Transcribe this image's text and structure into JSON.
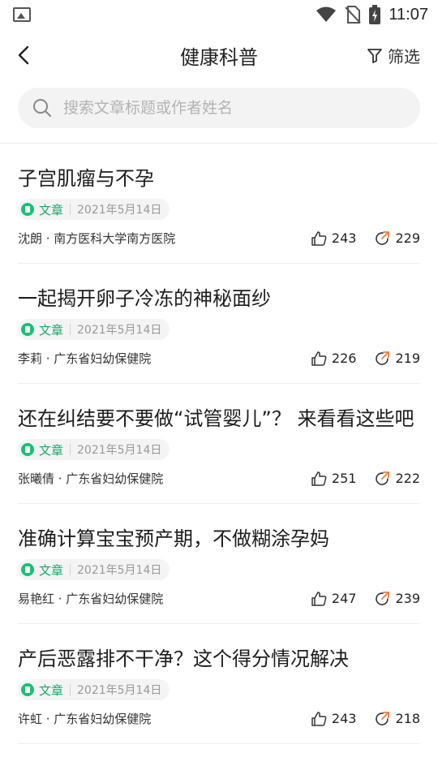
{
  "status_bar": {
    "time": "11:07"
  },
  "nav": {
    "title": "健康科普",
    "filter_label": "筛选"
  },
  "search": {
    "placeholder": "搜索文章标题或作者姓名"
  },
  "articles": [
    {
      "title": "子宫肌瘤与不孕",
      "type": "文章",
      "date": "2021年5月14日",
      "author": "沈朗 · 南方医科大学南方医院",
      "likes": "243",
      "shares": "229"
    },
    {
      "title": "一起揭开卵子冷冻的神秘面纱",
      "type": "文章",
      "date": "2021年5月14日",
      "author": "李莉 · 广东省妇幼保健院",
      "likes": "226",
      "shares": "219"
    },
    {
      "title": "还在纠结要不要做“试管婴儿”？ 来看看这些吧",
      "type": "文章",
      "date": "2021年5月14日",
      "author": "张曦倩 · 广东省妇幼保健院",
      "likes": "251",
      "shares": "222"
    },
    {
      "title": "准确计算宝宝预产期，不做糊涂孕妈",
      "type": "文章",
      "date": "2021年5月14日",
      "author": "易艳红 · 广东省妇幼保健院",
      "likes": "247",
      "shares": "239"
    },
    {
      "title": "产后恶露排不干净？这个得分情况解决",
      "type": "文章",
      "date": "2021年5月14日",
      "author": "许虹 · 广东省妇幼保健院",
      "likes": "243",
      "shares": "218"
    }
  ]
}
